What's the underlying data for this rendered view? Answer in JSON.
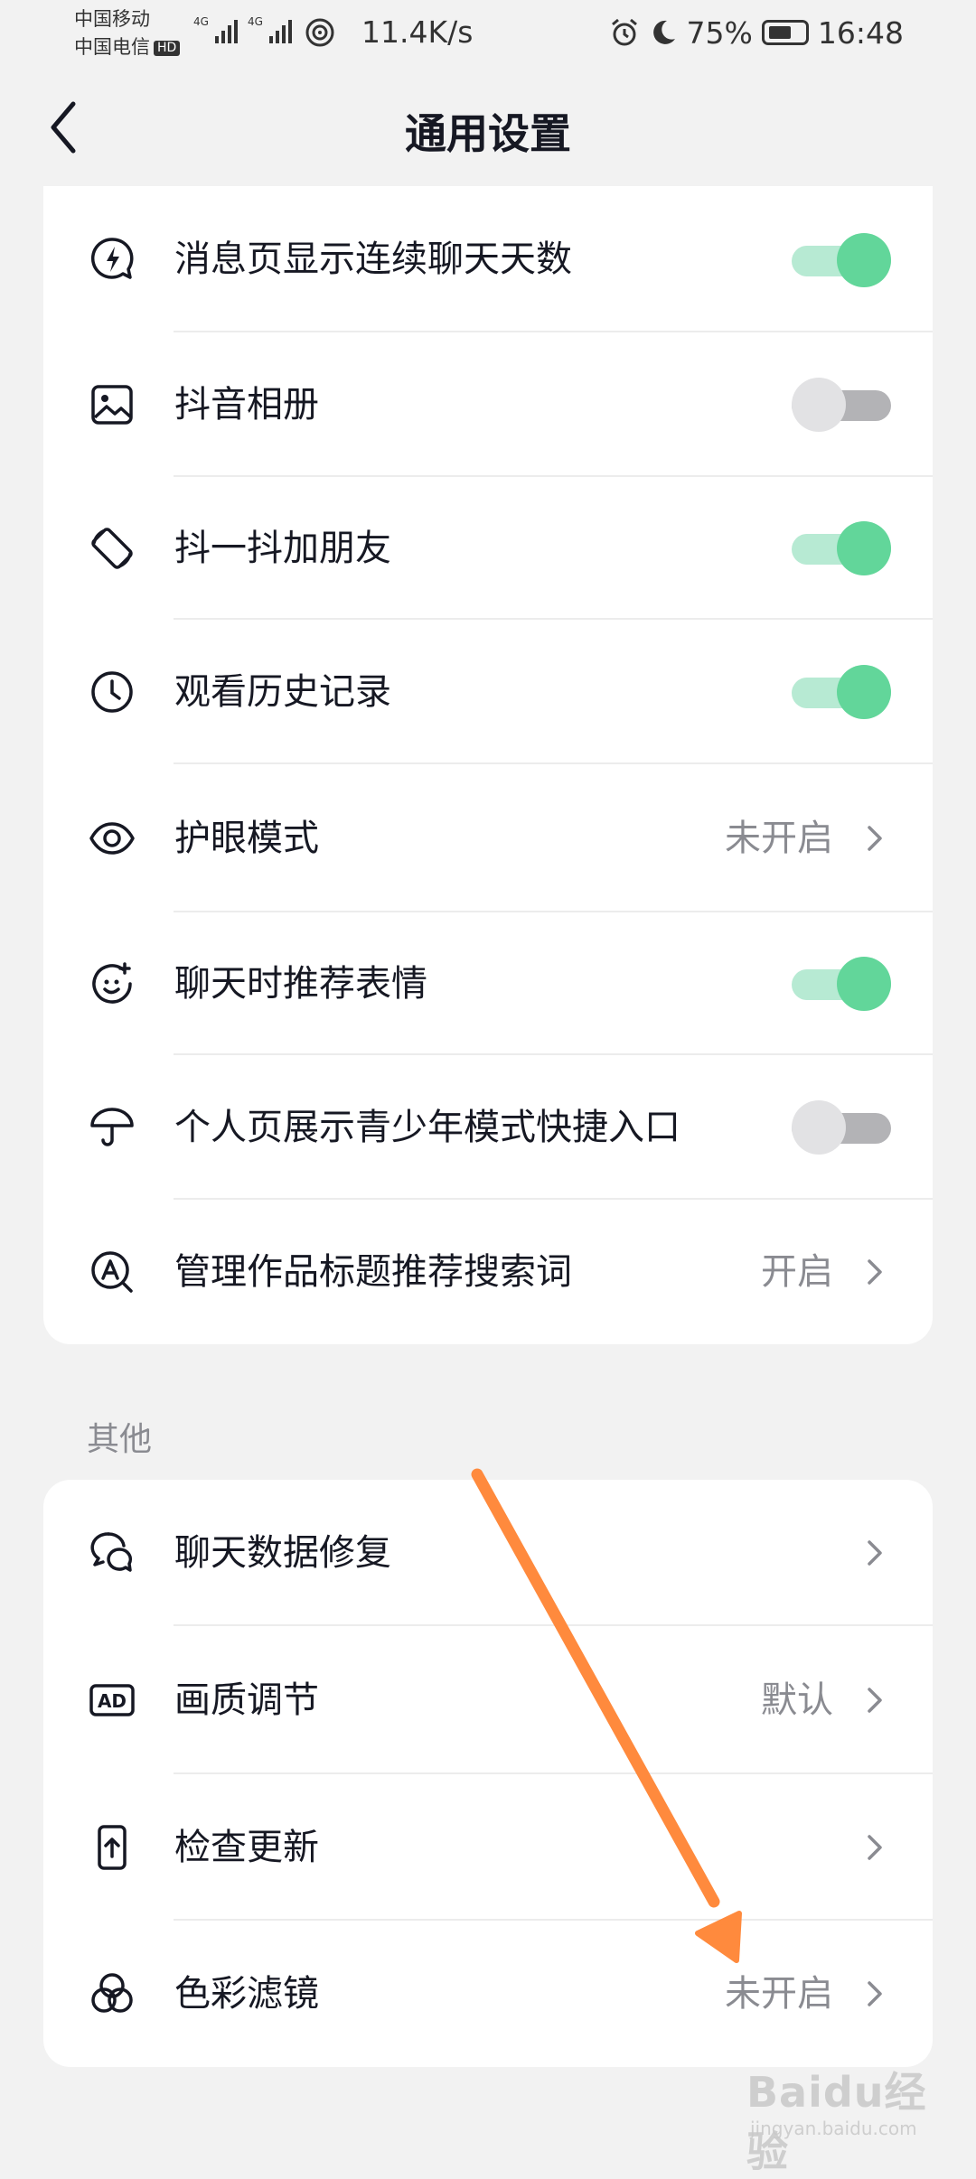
{
  "status_bar": {
    "carrier1": "中国移动",
    "carrier2": "中国电信",
    "hd": "HD",
    "net_speed": "11.4K/s",
    "battery": "75%",
    "time": "16:48"
  },
  "header": {
    "title": "通用设置"
  },
  "settings_top": [
    {
      "label": "消息页显示连续聊天天数",
      "icon": "bolt-bubble-icon",
      "control": "toggle",
      "on": true
    },
    {
      "label": "抖音相册",
      "icon": "image-icon",
      "control": "toggle",
      "on": false
    },
    {
      "label": "抖一抖加朋友",
      "icon": "rotate-phone-icon",
      "control": "toggle",
      "on": true
    },
    {
      "label": "观看历史记录",
      "icon": "clock-icon",
      "control": "toggle",
      "on": true
    },
    {
      "label": "护眼模式",
      "icon": "eye-icon",
      "control": "link",
      "value": "未开启"
    },
    {
      "label": "聊天时推荐表情",
      "icon": "emoji-icon",
      "control": "toggle",
      "on": true
    },
    {
      "label": "个人页展示青少年模式快捷入口",
      "icon": "umbrella-icon",
      "control": "toggle",
      "on": false
    },
    {
      "label": "管理作品标题推荐搜索词",
      "icon": "search-a-icon",
      "control": "link",
      "value": "开启"
    }
  ],
  "other_section": {
    "title": "其他",
    "items": [
      {
        "label": "聊天数据修复",
        "icon": "chat-repair-icon",
        "value": ""
      },
      {
        "label": "画质调节",
        "icon": "ad-icon",
        "value": "默认"
      },
      {
        "label": "检查更新",
        "icon": "phone-update-icon",
        "value": ""
      },
      {
        "label": "色彩滤镜",
        "icon": "color-filter-icon",
        "value": "未开启"
      }
    ]
  },
  "colors": {
    "toggle_on_knob": "#62d69a",
    "toggle_on_track": "#b7ead3",
    "toggle_off_knob": "#e2e2e4",
    "toggle_off_track": "#b3b3b6",
    "annotation_arrow": "#ff8a3d"
  },
  "watermark": {
    "logo": "Baidu经验",
    "url": "jingyan.baidu.com"
  }
}
